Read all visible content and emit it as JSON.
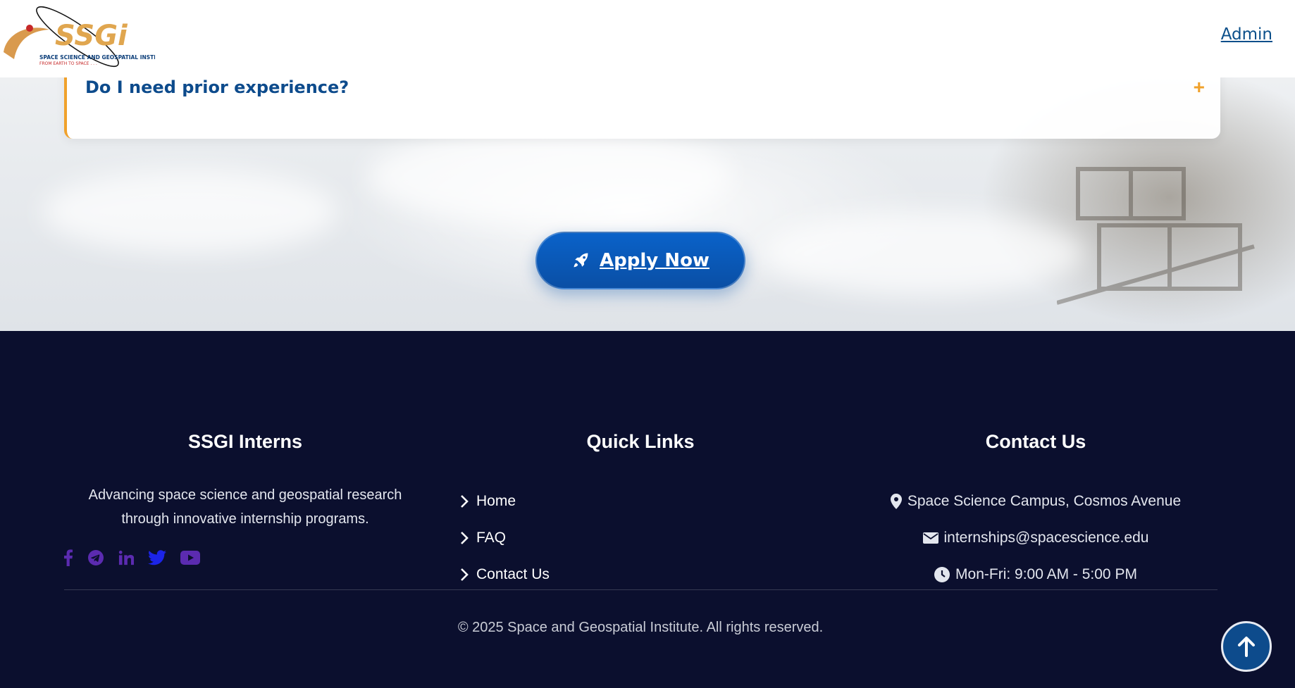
{
  "header": {
    "logo_text": "SSGI",
    "logo_subtitle": "SPACE SCIENCE AND GEOSPATIAL INSTITUTE",
    "logo_tagline": "FROM EARTH TO SPACE . . .",
    "admin_label": "Admin"
  },
  "faq": {
    "question": "Do I need prior experience?",
    "toggle_symbol": "+"
  },
  "apply": {
    "label": "Apply Now",
    "icon": "rocket-icon"
  },
  "footer": {
    "about": {
      "title": "SSGI Interns",
      "description": "Advancing space science and geospatial research through innovative internship programs."
    },
    "socials": [
      "facebook-icon",
      "telegram-icon",
      "linkedin-icon",
      "twitter-icon",
      "youtube-icon"
    ],
    "quick_links": {
      "title": "Quick Links",
      "items": [
        "Home",
        "FAQ",
        "Contact Us"
      ]
    },
    "contact": {
      "title": "Contact Us",
      "address": "Space Science Campus, Cosmos Avenue",
      "email": "internships@spacescience.edu",
      "hours": "Mon-Fri: 9:00 AM - 5:00 PM"
    },
    "copyright": "© 2025 Space and Geospatial Institute. All rights reserved."
  },
  "colors": {
    "brand_blue": "#0d4b8c",
    "accent_orange": "#f0a12b",
    "footer_bg": "#0b0f2e",
    "social_purple": "#5b2bb0"
  }
}
